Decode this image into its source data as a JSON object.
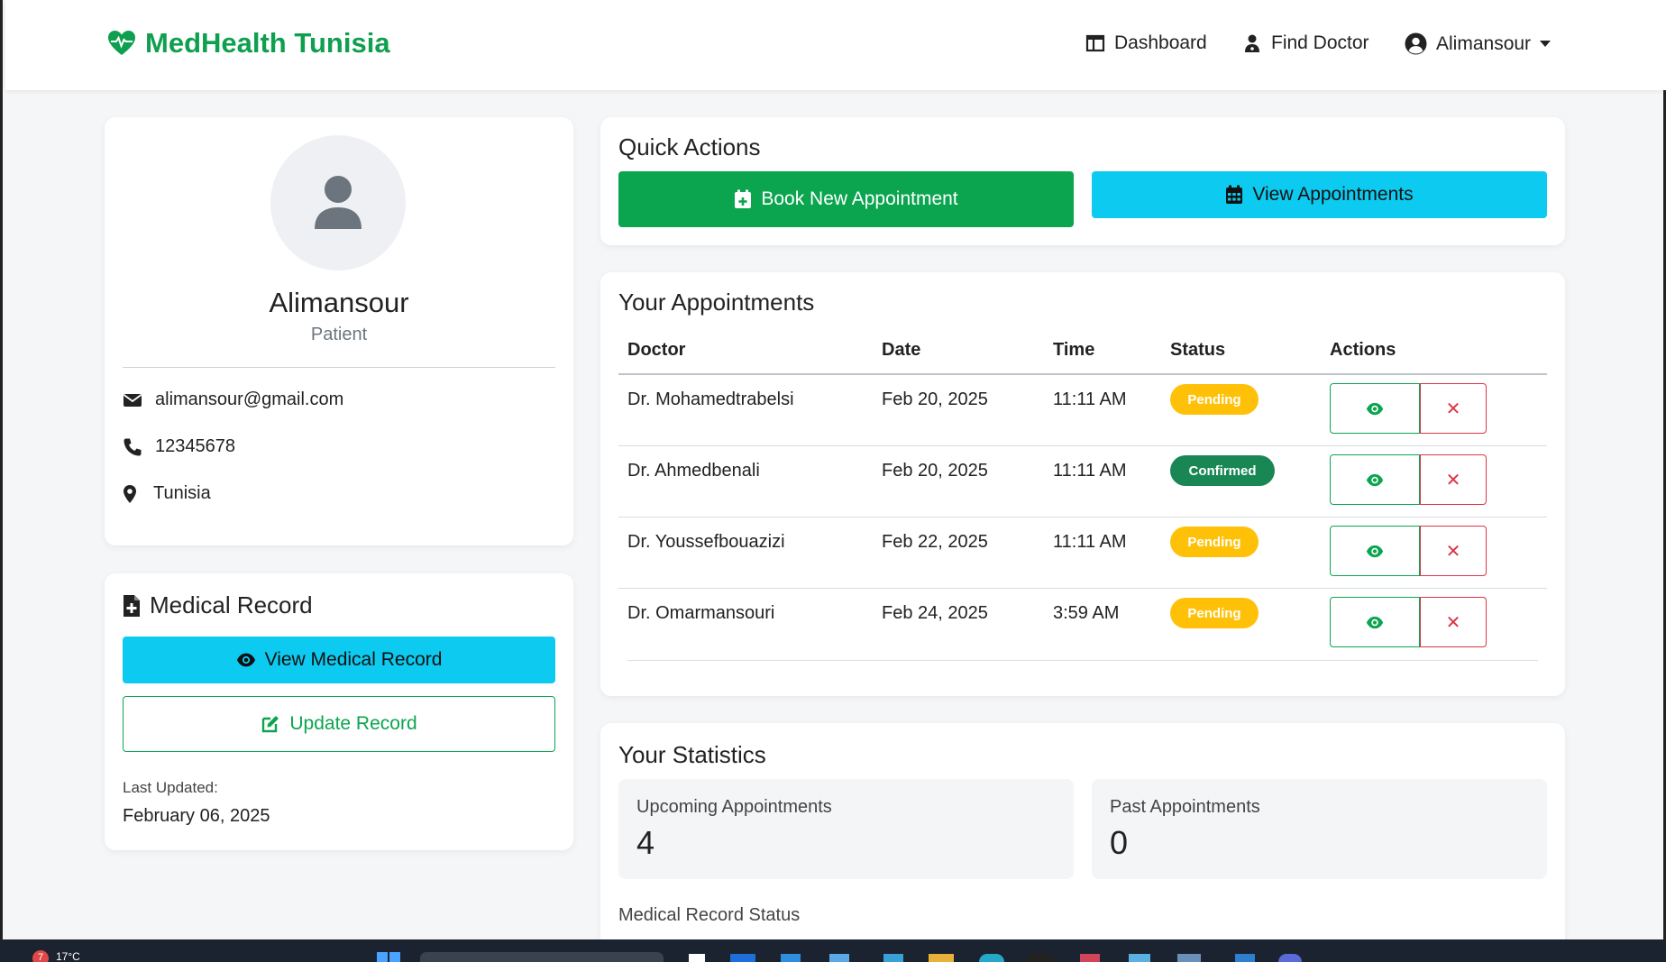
{
  "brand": {
    "name": "MedHealth Tunisia"
  },
  "nav": {
    "dashboard": "Dashboard",
    "find_doctor": "Find Doctor",
    "user": "Alimansour"
  },
  "profile": {
    "name": "Alimansour",
    "role": "Patient",
    "email": "alimansour@gmail.com",
    "phone": "12345678",
    "location": "Tunisia"
  },
  "medical_record": {
    "title": "Medical Record",
    "view_label": "View Medical Record",
    "update_label": "Update Record",
    "last_updated_label": "Last Updated:",
    "last_updated_value": "February 06, 2025"
  },
  "quick_actions": {
    "title": "Quick Actions",
    "book_label": "Book New Appointment",
    "view_label": "View Appointments"
  },
  "appointments": {
    "title": "Your Appointments",
    "headers": [
      "Doctor",
      "Date",
      "Time",
      "Status",
      "Actions"
    ],
    "rows": [
      {
        "doctor": "Dr. Mohamedtrabelsi",
        "date": "Feb 20, 2025",
        "time": "11:11 AM",
        "status": "Pending"
      },
      {
        "doctor": "Dr. Ahmedbenali",
        "date": "Feb 20, 2025",
        "time": "11:11 AM",
        "status": "Confirmed"
      },
      {
        "doctor": "Dr. Youssefbouazizi",
        "date": "Feb 22, 2025",
        "time": "11:11 AM",
        "status": "Pending"
      },
      {
        "doctor": "Dr. Omarmansouri",
        "date": "Feb 24, 2025",
        "time": "3:59 AM",
        "status": "Pending"
      }
    ]
  },
  "statistics": {
    "title": "Your Statistics",
    "upcoming_label": "Upcoming Appointments",
    "upcoming_value": "4",
    "past_label": "Past Appointments",
    "past_value": "0",
    "record_status_label": "Medical Record Status"
  },
  "taskbar": {
    "weather_badge": "7",
    "temperature": "17°C"
  },
  "colors": {
    "brand_green": "#0ba550",
    "cyan": "#0dcaf0",
    "pending": "#ffc107",
    "confirmed": "#198754",
    "danger": "#dc3545"
  }
}
